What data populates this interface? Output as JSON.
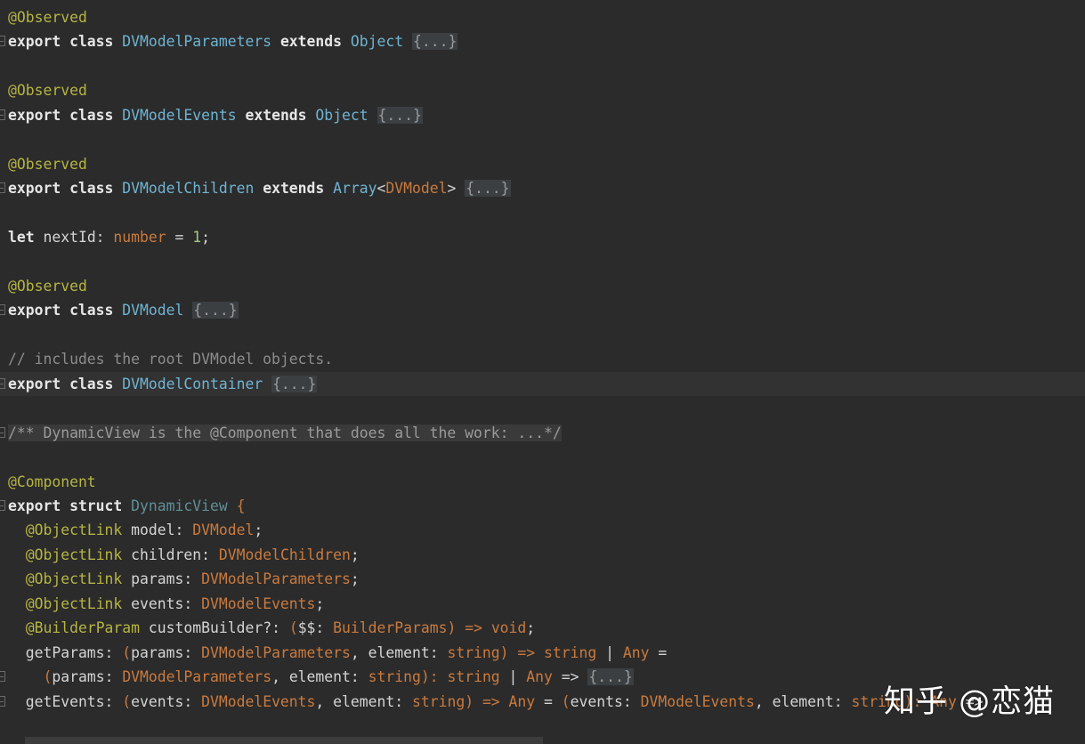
{
  "editor": {
    "lines": [
      {
        "segments": [
          {
            "t": "@Observed",
            "c": "ann"
          }
        ]
      },
      {
        "fold": true,
        "segments": [
          {
            "t": "export class ",
            "c": "kw"
          },
          {
            "t": "DVModelParameters",
            "c": "cls"
          },
          {
            "t": " ",
            "c": "plain"
          },
          {
            "t": "extends",
            "c": "kw"
          },
          {
            "t": " ",
            "c": "plain"
          },
          {
            "t": "Object",
            "c": "cls"
          },
          {
            "t": " ",
            "c": "plain"
          },
          {
            "t": "{...}",
            "c": "fold"
          }
        ]
      },
      {
        "segments": []
      },
      {
        "segments": [
          {
            "t": "@Observed",
            "c": "ann"
          }
        ]
      },
      {
        "fold": true,
        "segments": [
          {
            "t": "export class ",
            "c": "kw"
          },
          {
            "t": "DVModelEvents",
            "c": "cls"
          },
          {
            "t": " ",
            "c": "plain"
          },
          {
            "t": "extends",
            "c": "kw"
          },
          {
            "t": " ",
            "c": "plain"
          },
          {
            "t": "Object",
            "c": "cls"
          },
          {
            "t": " ",
            "c": "plain"
          },
          {
            "t": "{...}",
            "c": "fold"
          }
        ]
      },
      {
        "segments": []
      },
      {
        "segments": [
          {
            "t": "@Observed",
            "c": "ann"
          }
        ]
      },
      {
        "fold": true,
        "segments": [
          {
            "t": "export class ",
            "c": "kw"
          },
          {
            "t": "DVModelChildren",
            "c": "cls"
          },
          {
            "t": " ",
            "c": "plain"
          },
          {
            "t": "extends",
            "c": "kw"
          },
          {
            "t": " ",
            "c": "plain"
          },
          {
            "t": "Array",
            "c": "cls"
          },
          {
            "t": "<",
            "c": "plain"
          },
          {
            "t": "DVModel",
            "c": "type"
          },
          {
            "t": "> ",
            "c": "plain"
          },
          {
            "t": "{...}",
            "c": "fold"
          }
        ]
      },
      {
        "segments": []
      },
      {
        "segments": [
          {
            "t": "let",
            "c": "kw"
          },
          {
            "t": " nextId: ",
            "c": "plain"
          },
          {
            "t": "number",
            "c": "type"
          },
          {
            "t": " = ",
            "c": "plain"
          },
          {
            "t": "1",
            "c": "num"
          },
          {
            "t": ";",
            "c": "plain"
          }
        ]
      },
      {
        "segments": []
      },
      {
        "segments": [
          {
            "t": "@Observed",
            "c": "ann"
          }
        ]
      },
      {
        "fold": true,
        "segments": [
          {
            "t": "export class ",
            "c": "kw"
          },
          {
            "t": "DVModel",
            "c": "cls"
          },
          {
            "t": " ",
            "c": "plain"
          },
          {
            "t": "{...}",
            "c": "fold"
          }
        ]
      },
      {
        "segments": []
      },
      {
        "segments": [
          {
            "t": "// includes the root DVModel objects.",
            "c": "cmt"
          }
        ]
      },
      {
        "fold": true,
        "current": true,
        "segments": [
          {
            "t": "export class ",
            "c": "kw"
          },
          {
            "t": "DVModelContainer",
            "c": "cls"
          },
          {
            "t": " ",
            "c": "plain"
          },
          {
            "t": "{...}",
            "c": "fold"
          }
        ]
      },
      {
        "segments": []
      },
      {
        "fold": true,
        "segments": [
          {
            "t": "/** DynamicView is the @Component that does all the work: ...*/",
            "c": "doc-fold"
          }
        ]
      },
      {
        "segments": []
      },
      {
        "segments": [
          {
            "t": "@Component",
            "c": "ann"
          }
        ]
      },
      {
        "fold": true,
        "segments": [
          {
            "t": "export struct ",
            "c": "kw"
          },
          {
            "t": "DynamicView",
            "c": "struct-name"
          },
          {
            "t": " {",
            "c": "type"
          }
        ]
      },
      {
        "segments": [
          {
            "t": "  ",
            "c": "plain"
          },
          {
            "t": "@ObjectLink",
            "c": "ann"
          },
          {
            "t": " model: ",
            "c": "plain"
          },
          {
            "t": "DVModel",
            "c": "type"
          },
          {
            "t": ";",
            "c": "plain"
          }
        ]
      },
      {
        "segments": [
          {
            "t": "  ",
            "c": "plain"
          },
          {
            "t": "@ObjectLink",
            "c": "ann"
          },
          {
            "t": " children: ",
            "c": "plain"
          },
          {
            "t": "DVModelChildren",
            "c": "type"
          },
          {
            "t": ";",
            "c": "plain"
          }
        ]
      },
      {
        "segments": [
          {
            "t": "  ",
            "c": "plain"
          },
          {
            "t": "@ObjectLink",
            "c": "ann"
          },
          {
            "t": " params: ",
            "c": "plain"
          },
          {
            "t": "DVModelParameters",
            "c": "type"
          },
          {
            "t": ";",
            "c": "plain"
          }
        ]
      },
      {
        "segments": [
          {
            "t": "  ",
            "c": "plain"
          },
          {
            "t": "@ObjectLink",
            "c": "ann"
          },
          {
            "t": " events: ",
            "c": "plain"
          },
          {
            "t": "DVModelEvents",
            "c": "type"
          },
          {
            "t": ";",
            "c": "plain"
          }
        ]
      },
      {
        "segments": [
          {
            "t": "  ",
            "c": "plain"
          },
          {
            "t": "@BuilderParam",
            "c": "ann"
          },
          {
            "t": " customBuilder?: ",
            "c": "plain"
          },
          {
            "t": "(",
            "c": "type"
          },
          {
            "t": "$$: ",
            "c": "plain"
          },
          {
            "t": "BuilderParams",
            "c": "type"
          },
          {
            "t": ") => ",
            "c": "type"
          },
          {
            "t": "void",
            "c": "type"
          },
          {
            "t": ";",
            "c": "plain"
          }
        ]
      },
      {
        "segments": [
          {
            "t": "  getParams: ",
            "c": "plain"
          },
          {
            "t": "(",
            "c": "type"
          },
          {
            "t": "params: ",
            "c": "plain"
          },
          {
            "t": "DVModelParameters",
            "c": "type"
          },
          {
            "t": ", element: ",
            "c": "plain"
          },
          {
            "t": "string",
            "c": "type"
          },
          {
            "t": ") => ",
            "c": "type"
          },
          {
            "t": "string",
            "c": "type"
          },
          {
            "t": " | ",
            "c": "plain"
          },
          {
            "t": "Any",
            "c": "type"
          },
          {
            "t": " =",
            "c": "plain"
          }
        ]
      },
      {
        "fold": true,
        "segments": [
          {
            "t": "    ",
            "c": "plain"
          },
          {
            "t": "(",
            "c": "type"
          },
          {
            "t": "params: ",
            "c": "plain"
          },
          {
            "t": "DVModelParameters",
            "c": "type"
          },
          {
            "t": ", element: ",
            "c": "plain"
          },
          {
            "t": "string",
            "c": "type"
          },
          {
            "t": "): ",
            "c": "type"
          },
          {
            "t": "string",
            "c": "type"
          },
          {
            "t": " | ",
            "c": "plain"
          },
          {
            "t": "Any",
            "c": "type"
          },
          {
            "t": " => ",
            "c": "plain"
          },
          {
            "t": "{...}",
            "c": "fold"
          }
        ]
      },
      {
        "fold": true,
        "segments": [
          {
            "t": "  getEvents: ",
            "c": "plain"
          },
          {
            "t": "(",
            "c": "type"
          },
          {
            "t": "events: ",
            "c": "plain"
          },
          {
            "t": "DVModelEvents",
            "c": "type"
          },
          {
            "t": ", element: ",
            "c": "plain"
          },
          {
            "t": "string",
            "c": "type"
          },
          {
            "t": ") => ",
            "c": "type"
          },
          {
            "t": "Any",
            "c": "type"
          },
          {
            "t": " = ",
            "c": "plain"
          },
          {
            "t": "(",
            "c": "type"
          },
          {
            "t": "events: ",
            "c": "plain"
          },
          {
            "t": "DVModelEvents",
            "c": "type"
          },
          {
            "t": ", element: ",
            "c": "plain"
          },
          {
            "t": "string",
            "c": "type"
          },
          {
            "t": "): ",
            "c": "type"
          },
          {
            "t": "Any",
            "c": "type"
          },
          {
            "t": " =>",
            "c": "plain"
          }
        ]
      }
    ]
  },
  "watermark": "知乎 @恋猫"
}
